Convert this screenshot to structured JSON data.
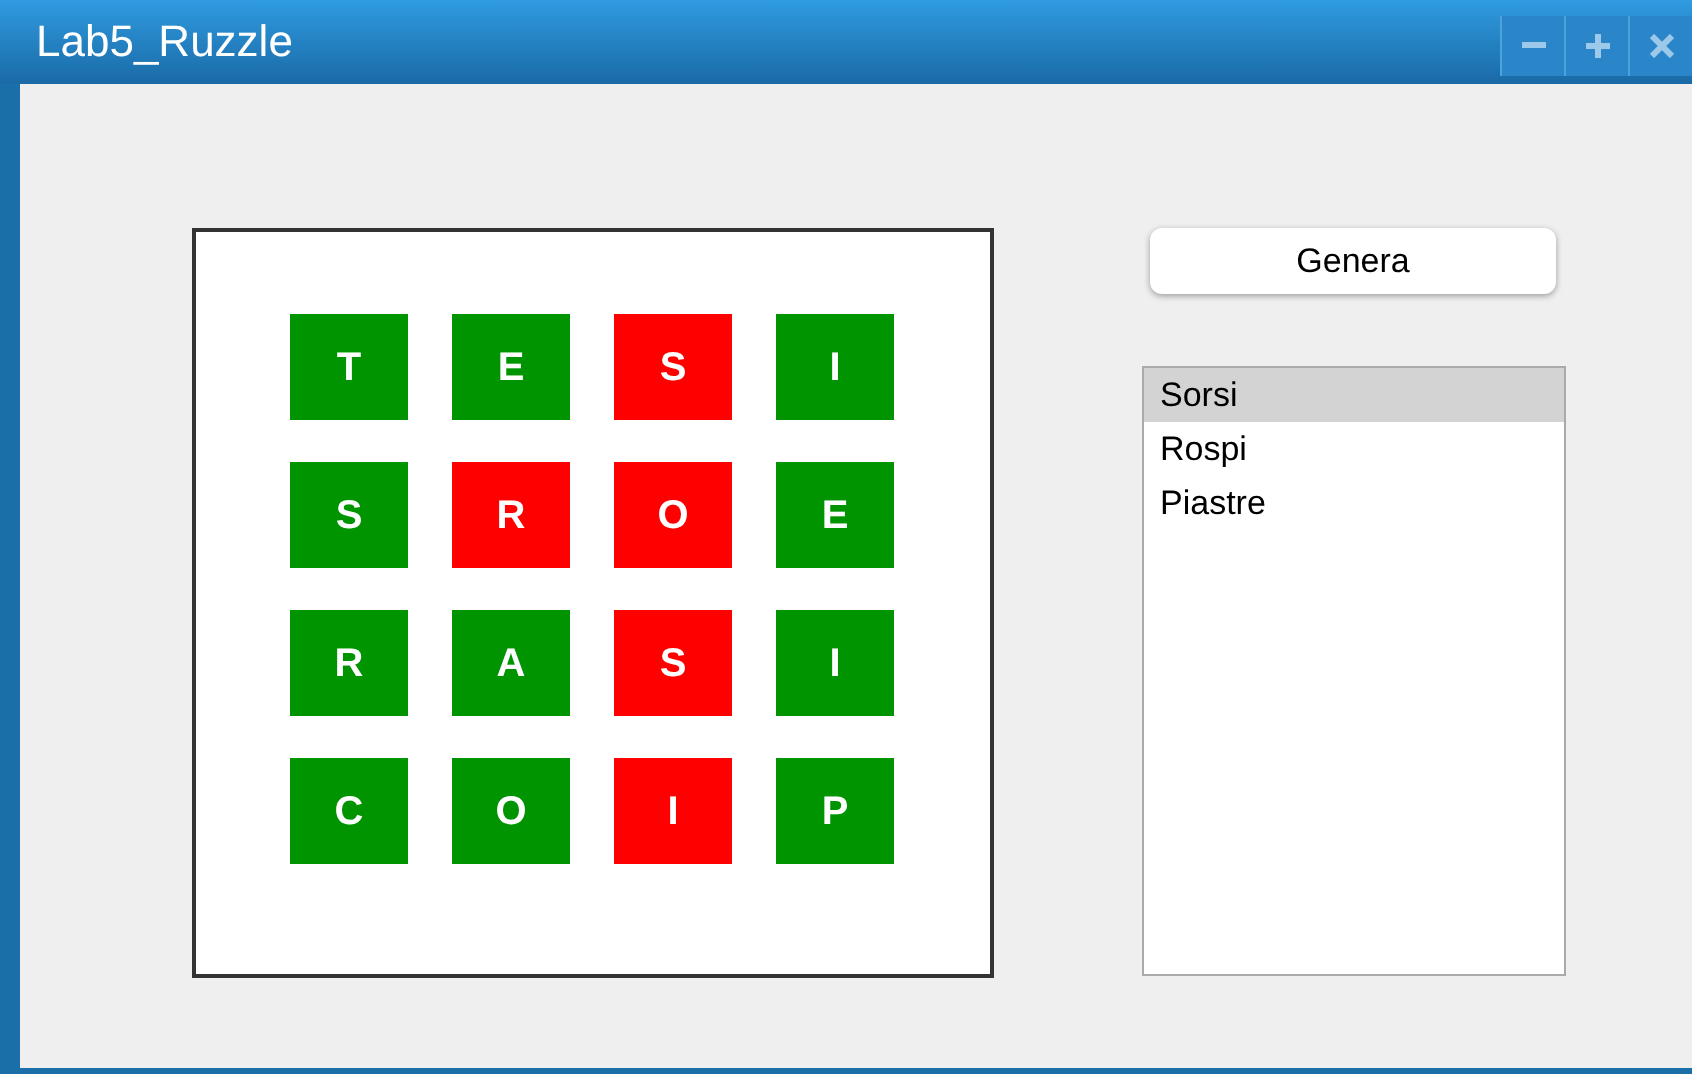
{
  "window": {
    "title": "Lab5_Ruzzle"
  },
  "board": {
    "rows": [
      [
        {
          "letter": "T",
          "highlighted": false
        },
        {
          "letter": "E",
          "highlighted": false
        },
        {
          "letter": "S",
          "highlighted": true
        },
        {
          "letter": "I",
          "highlighted": false
        }
      ],
      [
        {
          "letter": "S",
          "highlighted": false
        },
        {
          "letter": "R",
          "highlighted": true
        },
        {
          "letter": "O",
          "highlighted": true
        },
        {
          "letter": "E",
          "highlighted": false
        }
      ],
      [
        {
          "letter": "R",
          "highlighted": false
        },
        {
          "letter": "A",
          "highlighted": false
        },
        {
          "letter": "S",
          "highlighted": true
        },
        {
          "letter": "I",
          "highlighted": false
        }
      ],
      [
        {
          "letter": "C",
          "highlighted": false
        },
        {
          "letter": "O",
          "highlighted": false
        },
        {
          "letter": "I",
          "highlighted": true
        },
        {
          "letter": "P",
          "highlighted": false
        }
      ]
    ]
  },
  "generate_button": {
    "label": "Genera"
  },
  "words": [
    {
      "text": "Sorsi",
      "selected": true
    },
    {
      "text": "Rospi",
      "selected": false
    },
    {
      "text": "Piastre",
      "selected": false
    }
  ]
}
